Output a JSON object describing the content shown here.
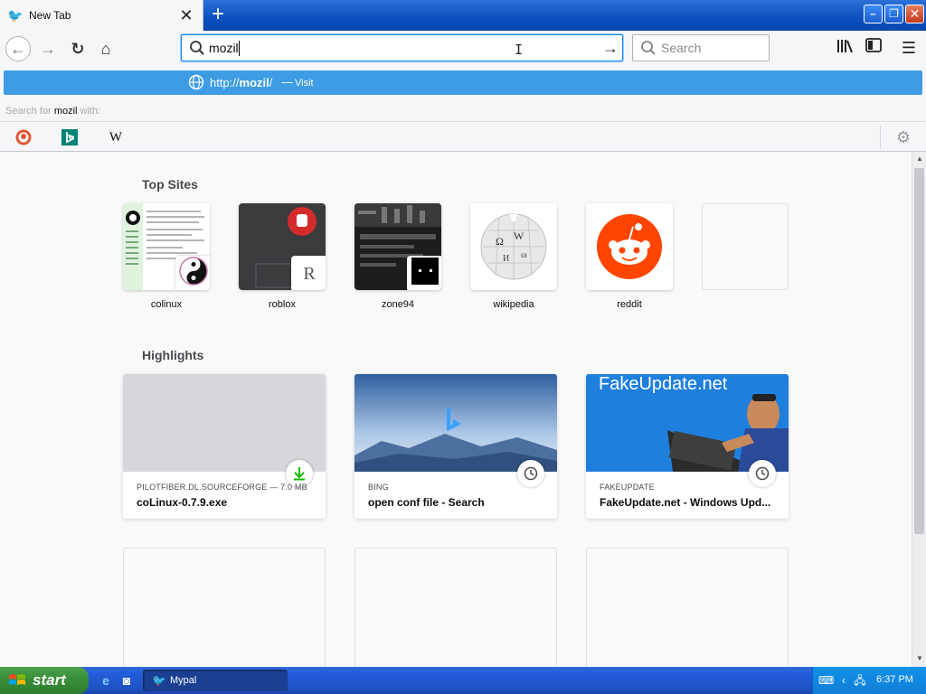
{
  "tab": {
    "title": "New Tab"
  },
  "urlbar": {
    "value": "mozil"
  },
  "searchbar": {
    "placeholder": "Search"
  },
  "suggestion": {
    "prefix": "http://",
    "host": "mozil",
    "suffix": "/",
    "dash": "—",
    "action": "Visit"
  },
  "search_with": {
    "before": "Search for ",
    "term": "mozil",
    "after": " with:"
  },
  "engines": {
    "wiki_letter": "W"
  },
  "top_sites": {
    "title": "Top Sites",
    "items": [
      {
        "label": "colinux"
      },
      {
        "label": "roblox",
        "badge": "R"
      },
      {
        "label": "zone94"
      },
      {
        "label": "wikipedia"
      },
      {
        "label": "reddit"
      },
      {
        "label": ""
      }
    ]
  },
  "highlights": {
    "title": "Highlights",
    "items": [
      {
        "source": "PILOTFIBER.DL.SOURCEFORGE — 7.0 MB",
        "title": "coLinux-0.7.9.exe"
      },
      {
        "source": "BING",
        "title": "open conf file - Search"
      },
      {
        "source": "FAKEUPDATE",
        "title": "FakeUpdate.net - Windows Upd...",
        "image_text": "FakeUpdate.net"
      }
    ]
  },
  "taskbar": {
    "start_label": "start",
    "task_label": "Mypal",
    "clock": "6:37 PM"
  },
  "colors": {
    "accent": "#0a84ff",
    "suggestion_bg": "#3d9ce3",
    "xp_blue": "#245edb",
    "start_green": "#3a8f3a",
    "reddit": "#ff4500"
  }
}
